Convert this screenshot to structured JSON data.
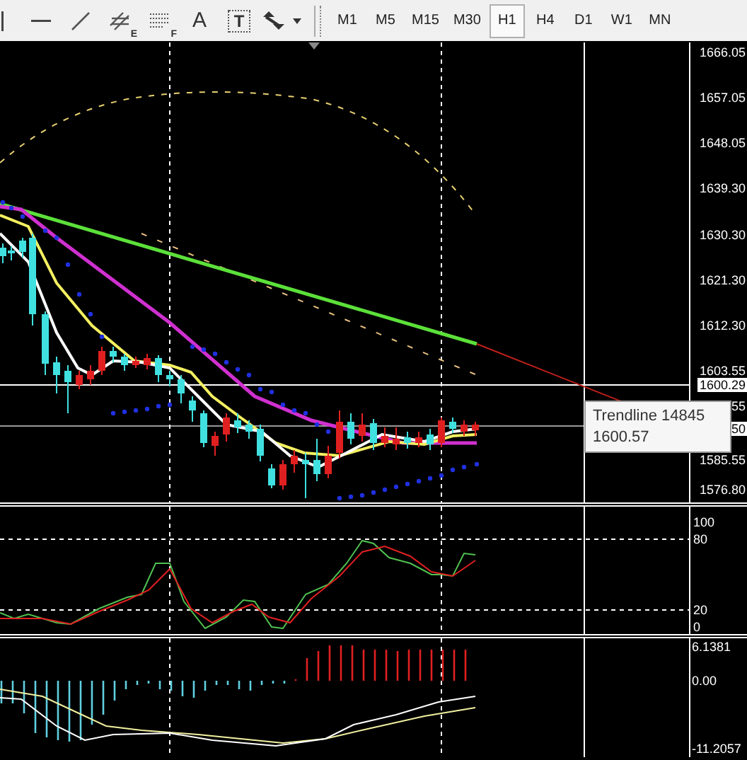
{
  "toolbar": {
    "text_tool": "A",
    "label_tool": "T",
    "channel_tool_mark": "E",
    "fibo_tool_mark": "F",
    "timeframes": [
      {
        "label": "M1",
        "selected": false
      },
      {
        "label": "M5",
        "selected": false
      },
      {
        "label": "M15",
        "selected": false
      },
      {
        "label": "M30",
        "selected": false
      },
      {
        "label": "H1",
        "selected": true
      },
      {
        "label": "H4",
        "selected": false
      },
      {
        "label": "D1",
        "selected": false
      },
      {
        "label": "W1",
        "selected": false
      },
      {
        "label": "MN",
        "selected": false
      }
    ]
  },
  "price_axis": {
    "labels": [
      "1666.05",
      "1657.05",
      "1648.05",
      "1639.30",
      "1630.30",
      "1621.30",
      "1612.30",
      "1603.55",
      "55",
      "1585.55",
      "1576.80"
    ],
    "current_price": "1600.29",
    "crosshair_price": "50"
  },
  "tooltip": {
    "title": "Trendline 14845",
    "value": "1600.57"
  },
  "stochastic_axis": {
    "labels": [
      "100",
      "80",
      "20",
      "0"
    ]
  },
  "macd_axis": {
    "labels": [
      "6.1381",
      "0.00",
      "-11.2057"
    ]
  }
}
